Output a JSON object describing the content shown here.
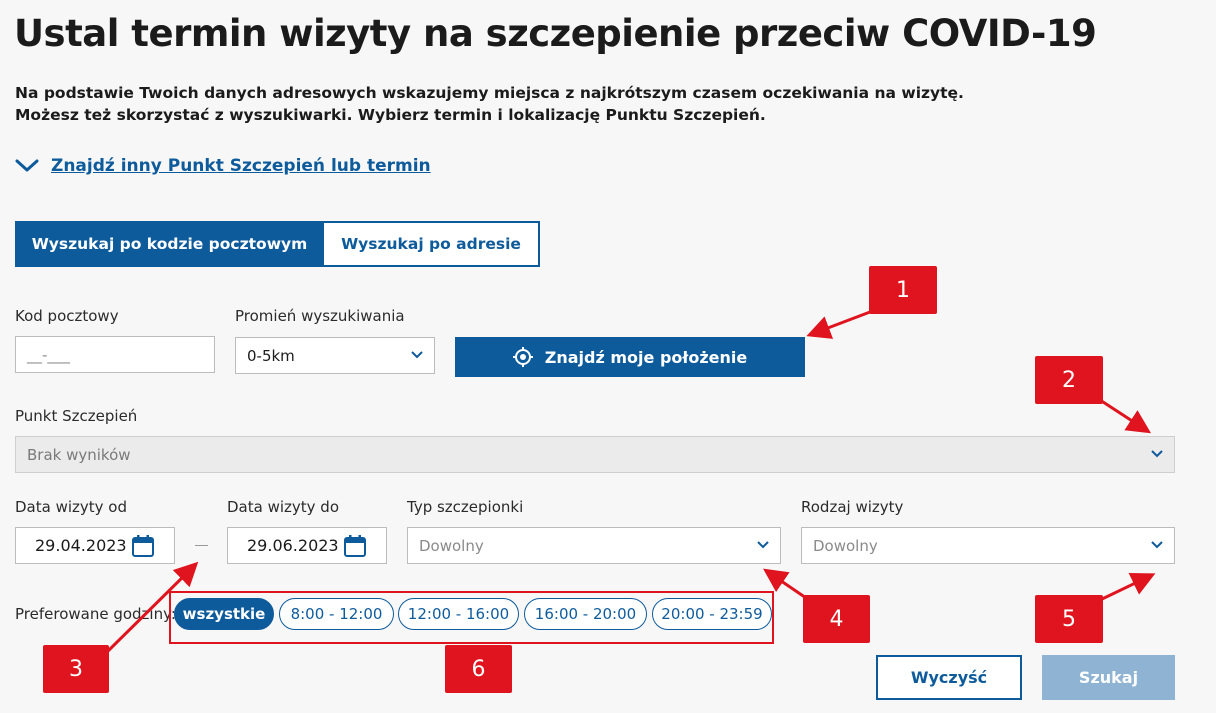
{
  "page": {
    "title": "Ustal termin wizyty na szczepienie przeciw COVID-19",
    "intro_line1": "Na podstawie Twoich danych adresowych wskazujemy miejsca z najkrótszym czasem oczekiwania na wizytę.",
    "intro_line2": "Możesz też skorzystać z wyszukiwarki. Wybierz termin i lokalizację Punktu Szczepień."
  },
  "find_link": {
    "label": "Znajdź inny Punkt Szczepień lub termin",
    "icon": "chevron-down-icon"
  },
  "tabs": [
    {
      "label": "Wyszukaj po kodzie pocztowym",
      "active": true
    },
    {
      "label": "Wyszukaj po adresie",
      "active": false
    }
  ],
  "postal": {
    "label": "Kod pocztowy",
    "placeholder": "__-___"
  },
  "radius": {
    "label": "Promień wyszukiwania",
    "value": "0-5km"
  },
  "locate_button": {
    "label": "Znajdź moje położenie",
    "icon": "crosshair-icon"
  },
  "vaccination_point": {
    "label": "Punkt Szczepień",
    "value": "Brak wyników"
  },
  "date_from": {
    "label": "Data wizyty od",
    "value": "29.04.2023"
  },
  "date_to": {
    "label": "Data wizyty do",
    "value": "29.06.2023"
  },
  "vaccine_type": {
    "label": "Typ szczepionki",
    "value": "Dowolny"
  },
  "visit_kind": {
    "label": "Rodzaj wizyty",
    "value": "Dowolny"
  },
  "hours": {
    "label": "Preferowane godziny:",
    "options": [
      "wszystkie",
      "8:00 - 12:00",
      "12:00 - 16:00",
      "16:00 - 20:00",
      "20:00 - 23:59"
    ],
    "selected": "wszystkie"
  },
  "buttons": {
    "clear": "Wyczyść",
    "search": "Szukaj"
  },
  "annotations": [
    "1",
    "2",
    "3",
    "4",
    "5",
    "6"
  ],
  "colors": {
    "primary": "#0e5b9c",
    "disabled_button": "#8fb4d3",
    "annotation": "#e0141e",
    "background": "#f7f7f7"
  }
}
